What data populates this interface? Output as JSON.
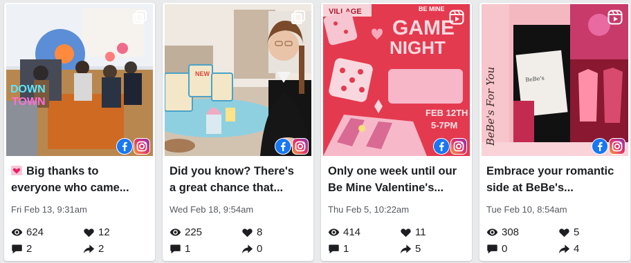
{
  "posts": [
    {
      "caption_lines": [
        "Big thanks to",
        "everyone who came..."
      ],
      "has_heart_emoji": true,
      "date": "Fri Feb 13, 9:31am",
      "views": "624",
      "likes": "12",
      "comments": "2",
      "shares": "2",
      "corner_icon": "carousel-icon",
      "image_text": [
        "DOWN",
        "TOWN"
      ]
    },
    {
      "caption_lines": [
        "Did you know? There's",
        "a great chance that..."
      ],
      "has_heart_emoji": false,
      "date": "Wed Feb 18, 9:54am",
      "views": "225",
      "likes": "8",
      "comments": "1",
      "shares": "0",
      "corner_icon": "carousel-icon",
      "image_text": [
        "NEW"
      ]
    },
    {
      "caption_lines": [
        "Only one week until our",
        "Be Mine Valentine's..."
      ],
      "has_heart_emoji": false,
      "date": "Thu Feb 5, 10:22am",
      "views": "414",
      "likes": "11",
      "comments": "1",
      "shares": "5",
      "corner_icon": "reel-icon",
      "image_text": [
        "VILLAGE",
        "BE MINE",
        "GAME",
        "NIGHT",
        "FEB 12TH",
        "5-7PM"
      ]
    },
    {
      "caption_lines": [
        "Embrace your romantic",
        "side at BeBe's..."
      ],
      "has_heart_emoji": false,
      "date": "Tue Feb 10, 8:54am",
      "views": "308",
      "likes": "5",
      "comments": "0",
      "shares": "4",
      "corner_icon": "reel-icon",
      "image_text": [
        "BeBe's For You"
      ]
    }
  ],
  "colors": {
    "facebook": "#1877f2",
    "instagram_start": "#f9a13a",
    "instagram_mid": "#e1306c",
    "instagram_end": "#833ab4",
    "text_primary": "#1c1e21",
    "text_secondary": "#55595f",
    "game_night_bg": "#e43a4f",
    "bebe_pink": "#f7c6cc"
  }
}
